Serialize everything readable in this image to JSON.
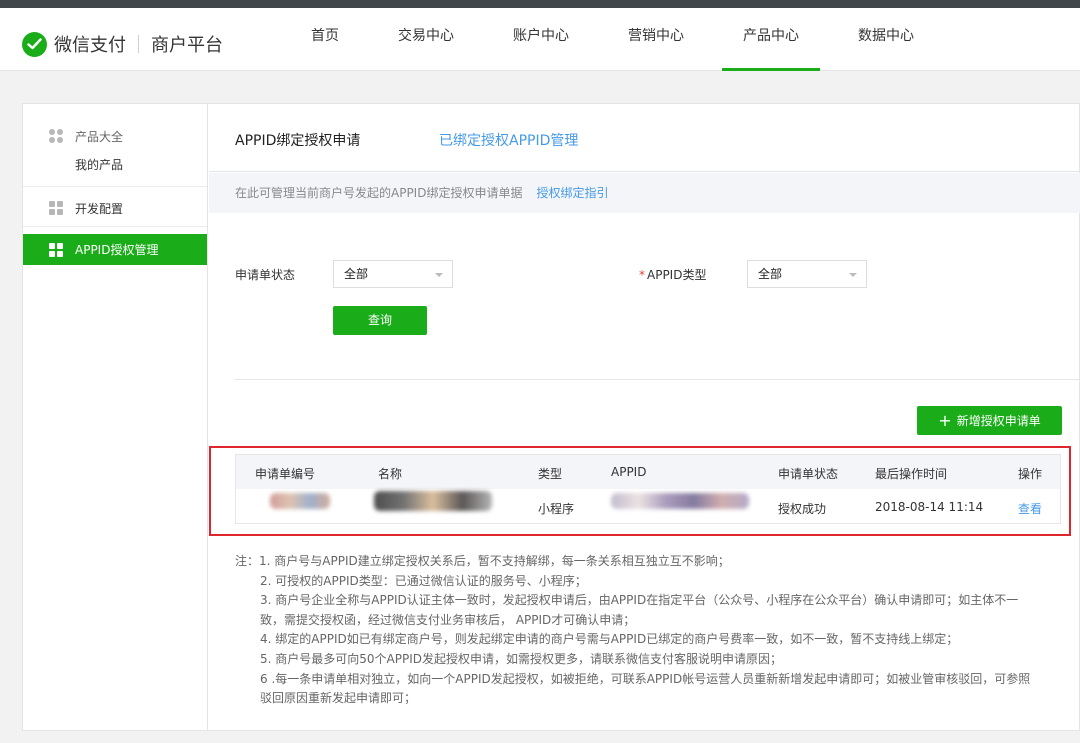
{
  "brand": {
    "name": "微信支付",
    "sub": "商户平台",
    "icon": "wechat-pay-logo-icon"
  },
  "nav": [
    {
      "label": "首页",
      "active": false
    },
    {
      "label": "交易中心",
      "active": false
    },
    {
      "label": "账户中心",
      "active": false
    },
    {
      "label": "营销中心",
      "active": false
    },
    {
      "label": "产品中心",
      "active": true
    },
    {
      "label": "数据中心",
      "active": false
    }
  ],
  "sidebar": {
    "group1": {
      "title": "产品大全",
      "sub": "我的产品"
    },
    "group2": {
      "title": "开发配置"
    },
    "group3": {
      "title": "APPID授权管理",
      "active": true
    }
  },
  "tabs": {
    "current": "APPID绑定授权申请",
    "other": "已绑定授权APPID管理"
  },
  "tip": {
    "text": "在此可管理当前商户号发起的APPID绑定授权申请单据",
    "link": "授权绑定指引"
  },
  "filters": {
    "status_label": "申请单状态",
    "status_value": "全部",
    "type_label": "APPID类型",
    "type_value": "全部",
    "query_button": "查询"
  },
  "add_button": "新增授权申请单",
  "table": {
    "headers": [
      "申请单编号",
      "名称",
      "类型",
      "APPID",
      "申请单状态",
      "最后操作时间",
      "操作"
    ],
    "row": {
      "type": "小程序",
      "status": "授权成功",
      "time": "2018-08-14 11:14",
      "action": "查看"
    }
  },
  "notes": {
    "prefix": "注：",
    "lines": [
      "1. 商户号与APPID建立绑定授权关系后，暂不支持解绑，每一条关系相互独立互不影响；",
      "2. 可授权的APPID类型：已通过微信认证的服务号、小程序；",
      "3. 商户号企业全称与APPID认证主体一致时，发起授权申请后，由APPID在指定平台（公众号、小程序在公众平台）确认申请即可；如主体不一",
      "致，需提交授权函，经过微信支付业务审核后， APPID才可确认申请；",
      "4. 绑定的APPID如已有绑定商户号，则发起绑定申请的商户号需与APPID已绑定的商户号费率一致，如不一致，暂不支持线上绑定；",
      "5. 商户号最多可向50个APPID发起授权申请，如需授权更多，请联系微信支付客服说明申请原因；",
      "6 .每一条申请单相对独立，如向一个APPID发起授权，如被拒绝，可联系APPID帐号运营人员重新新增发起申请即可；如被业管审核驳回，可参照",
      "驳回原因重新发起申请即可；"
    ]
  },
  "colors": {
    "brand_green": "#1aad19",
    "link_blue": "#459ae9",
    "highlight_red": "#e0262b"
  }
}
